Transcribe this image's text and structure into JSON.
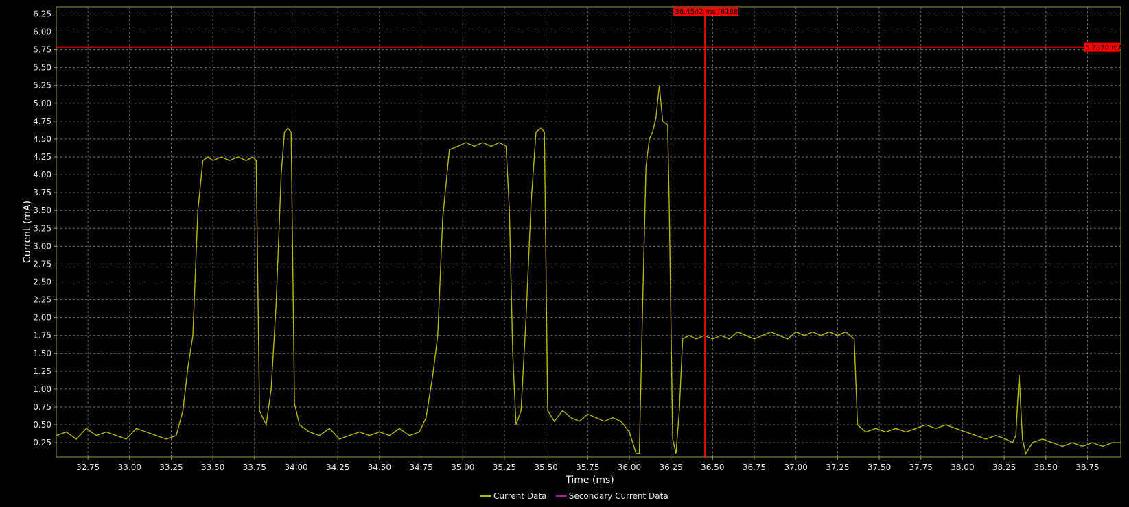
{
  "chart_data": {
    "type": "line",
    "title": "",
    "xlabel": "Time (ms)",
    "ylabel": "Current (mA)",
    "xlim": [
      32.56,
      38.95
    ],
    "ylim": [
      0.05,
      6.35
    ],
    "x_ticks": [
      "32.75",
      "33.00",
      "33.25",
      "33.50",
      "33.75",
      "34.00",
      "34.25",
      "34.50",
      "34.75",
      "35.00",
      "35.25",
      "35.50",
      "35.75",
      "36.00",
      "36.25",
      "36.50",
      "36.75",
      "37.00",
      "37.25",
      "37.50",
      "37.75",
      "38.00",
      "38.25",
      "38.50",
      "38.75"
    ],
    "y_ticks": [
      "0.25",
      "0.50",
      "0.75",
      "1.00",
      "1.25",
      "1.50",
      "1.75",
      "2.00",
      "2.25",
      "2.50",
      "2.75",
      "3.00",
      "3.25",
      "3.50",
      "3.75",
      "4.00",
      "4.25",
      "4.50",
      "4.75",
      "5.00",
      "5.25",
      "5.50",
      "5.75",
      "6.00",
      "6.25"
    ],
    "grid": true,
    "legend_position": "bottom-center",
    "series": [
      {
        "name": "Current Data",
        "color": "#b8b800",
        "x": [
          32.56,
          32.62,
          32.68,
          32.74,
          32.8,
          32.86,
          32.92,
          32.98,
          33.04,
          33.1,
          33.16,
          33.22,
          33.28,
          33.32,
          33.35,
          33.38,
          33.41,
          33.44,
          33.47,
          33.5,
          33.55,
          33.6,
          33.65,
          33.7,
          33.74,
          33.76,
          33.78,
          33.82,
          33.85,
          33.88,
          33.91,
          33.93,
          33.95,
          33.97,
          33.99,
          34.02,
          34.08,
          34.14,
          34.2,
          34.26,
          34.32,
          34.38,
          34.44,
          34.5,
          34.56,
          34.62,
          34.68,
          34.74,
          34.78,
          34.82,
          34.85,
          34.88,
          34.92,
          34.97,
          35.02,
          35.07,
          35.12,
          35.17,
          35.22,
          35.26,
          35.28,
          35.3,
          35.32,
          35.35,
          35.38,
          35.41,
          35.44,
          35.47,
          35.49,
          35.51,
          35.55,
          35.6,
          35.65,
          35.7,
          35.75,
          35.8,
          35.85,
          35.9,
          35.95,
          36.0,
          36.04,
          36.06,
          36.08,
          36.1,
          36.12,
          36.14,
          36.16,
          36.18,
          36.2,
          36.23,
          36.24,
          36.26,
          36.28,
          36.3,
          36.32,
          36.36,
          36.4,
          36.45,
          36.5,
          36.55,
          36.6,
          36.65,
          36.7,
          36.75,
          36.8,
          36.85,
          36.9,
          36.95,
          37.0,
          37.05,
          37.1,
          37.15,
          37.2,
          37.25,
          37.3,
          37.35,
          37.37,
          37.42,
          37.48,
          37.54,
          37.6,
          37.66,
          37.72,
          37.78,
          37.84,
          37.9,
          37.96,
          38.02,
          38.08,
          38.14,
          38.2,
          38.26,
          38.3,
          38.32,
          38.34,
          38.36,
          38.38,
          38.42,
          38.48,
          38.54,
          38.6,
          38.66,
          38.72,
          38.78,
          38.84,
          38.9,
          38.95
        ],
        "y": [
          0.35,
          0.4,
          0.3,
          0.45,
          0.35,
          0.4,
          0.35,
          0.3,
          0.45,
          0.4,
          0.35,
          0.3,
          0.35,
          0.7,
          1.3,
          1.75,
          3.5,
          4.2,
          4.25,
          4.2,
          4.25,
          4.2,
          4.25,
          4.2,
          4.25,
          4.2,
          0.7,
          0.5,
          1.0,
          2.2,
          4.0,
          4.6,
          4.65,
          4.6,
          0.8,
          0.5,
          0.4,
          0.35,
          0.45,
          0.3,
          0.35,
          0.4,
          0.35,
          0.4,
          0.35,
          0.45,
          0.35,
          0.4,
          0.6,
          1.2,
          1.75,
          3.4,
          4.35,
          4.4,
          4.45,
          4.4,
          4.45,
          4.4,
          4.45,
          4.4,
          3.5,
          1.5,
          0.5,
          0.7,
          2.0,
          3.6,
          4.6,
          4.65,
          4.6,
          0.7,
          0.55,
          0.7,
          0.6,
          0.55,
          0.65,
          0.6,
          0.55,
          0.6,
          0.55,
          0.4,
          0.1,
          0.1,
          2.2,
          4.1,
          4.5,
          4.6,
          4.8,
          5.25,
          4.75,
          4.7,
          3.5,
          0.3,
          0.1,
          0.7,
          1.7,
          1.75,
          1.7,
          1.75,
          1.7,
          1.75,
          1.7,
          1.8,
          1.75,
          1.7,
          1.75,
          1.8,
          1.75,
          1.7,
          1.8,
          1.75,
          1.8,
          1.75,
          1.8,
          1.75,
          1.8,
          1.7,
          0.5,
          0.4,
          0.45,
          0.4,
          0.45,
          0.4,
          0.45,
          0.5,
          0.45,
          0.5,
          0.45,
          0.4,
          0.35,
          0.3,
          0.35,
          0.3,
          0.25,
          0.35,
          1.2,
          0.3,
          0.1,
          0.25,
          0.3,
          0.25,
          0.2,
          0.25,
          0.2,
          0.25,
          0.2,
          0.25,
          0.25
        ]
      },
      {
        "name": "Secondary Current Data",
        "color": "#a020a0",
        "x": [],
        "y": []
      }
    ],
    "cursor_vertical": {
      "x": 36.4542,
      "label": "36.4542 ms (6188)"
    },
    "cursor_horizontal": {
      "y": 5.787,
      "label": "5.7870 mA"
    },
    "colors": {
      "background": "#000000",
      "grid": "#6e6e6e",
      "frame": "#9a9a3a",
      "cursor": "#ff0000"
    }
  }
}
